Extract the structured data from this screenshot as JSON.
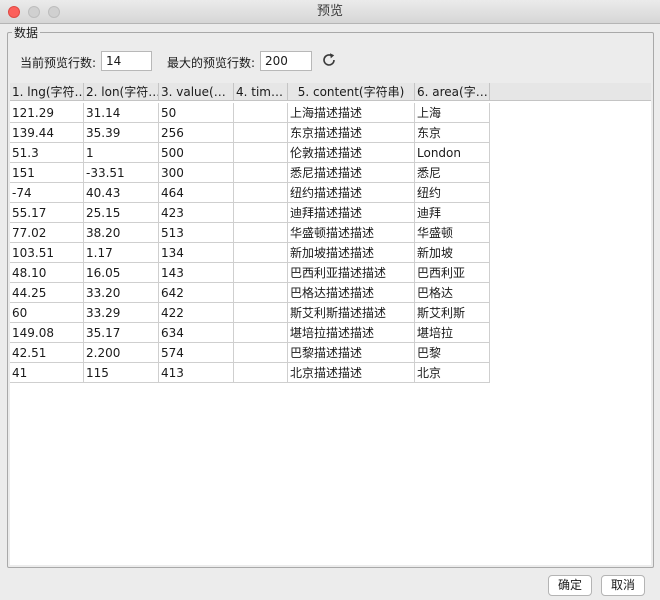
{
  "window": {
    "title": "预览"
  },
  "group": {
    "label": "数据"
  },
  "controls": {
    "current_rows_label": "当前预览行数:",
    "current_rows_value": "14",
    "max_rows_label": "最大的预览行数:",
    "max_rows_value": "200",
    "refresh_icon": "refresh-icon"
  },
  "table": {
    "headers": [
      "1. lng(字符…",
      "2. lon(字符…",
      "3. value(…",
      "4. tim…",
      "5. content(字符串)",
      "6. area(字…"
    ],
    "rows": [
      [
        "121.29",
        "31.14",
        "50",
        "",
        "上海描述描述",
        "上海"
      ],
      [
        "139.44",
        "35.39",
        "256",
        "",
        "东京描述描述",
        "东京"
      ],
      [
        "51.3",
        "1",
        "500",
        "",
        "伦敦描述描述",
        "London"
      ],
      [
        "151",
        "-33.51",
        "300",
        "",
        "悉尼描述描述",
        "悉尼"
      ],
      [
        "-74",
        "40.43",
        "464",
        "",
        "纽约描述描述",
        "纽约"
      ],
      [
        "55.17",
        "25.15",
        "423",
        "",
        "迪拜描述描述",
        "迪拜"
      ],
      [
        "77.02",
        "38.20",
        "513",
        "",
        "华盛顿描述描述",
        "华盛顿"
      ],
      [
        "103.51",
        "1.17",
        "134",
        "",
        "新加坡描述描述",
        "新加坡"
      ],
      [
        "48.10",
        "16.05",
        "143",
        "",
        "巴西利亚描述描述",
        "巴西利亚"
      ],
      [
        "44.25",
        "33.20",
        "642",
        "",
        "巴格达描述描述",
        "巴格达"
      ],
      [
        "60",
        "33.29",
        "422",
        "",
        "斯艾利斯描述描述",
        "斯艾利斯"
      ],
      [
        "149.08",
        "35.17",
        "634",
        "",
        "堪培拉描述描述",
        "堪培拉"
      ],
      [
        "42.51",
        "2.200",
        "574",
        "",
        "巴黎描述描述",
        "巴黎"
      ],
      [
        "41",
        "115",
        "413",
        "",
        "北京描述描述",
        "北京"
      ]
    ]
  },
  "buttons": {
    "ok": "确定",
    "cancel": "取消"
  }
}
